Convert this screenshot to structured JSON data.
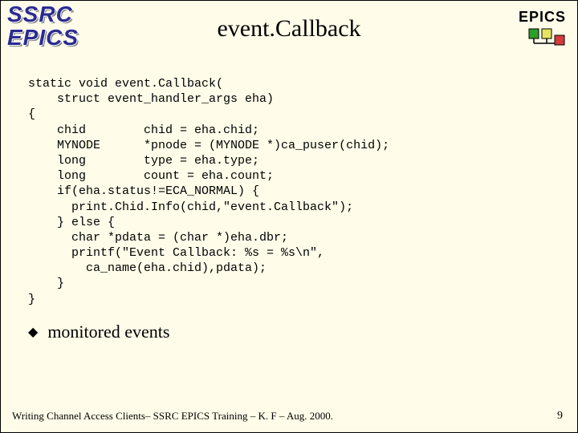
{
  "logo": {
    "line1": "SSRC",
    "line2": "EPICS"
  },
  "title": "event.Callback",
  "epics_label": "EPICS",
  "code": "static void event.Callback(\n    struct event_handler_args eha)\n{\n    chid        chid = eha.chid;\n    MYNODE      *pnode = (MYNODE *)ca_puser(chid);\n    long        type = eha.type;\n    long        count = eha.count;\n    if(eha.status!=ECA_NORMAL) {\n      print.Chid.Info(chid,\"event.Callback\");\n    } else {\n      char *pdata = (char *)eha.dbr;\n      printf(\"Event Callback: %s = %s\\n\",\n        ca_name(eha.chid),pdata);\n    }\n}",
  "bullet": {
    "marker": "◆",
    "text": "monitored events"
  },
  "footer": "Writing Channel Access Clients– SSRC EPICS Training – K. F – Aug. 2000.",
  "page_number": "9"
}
